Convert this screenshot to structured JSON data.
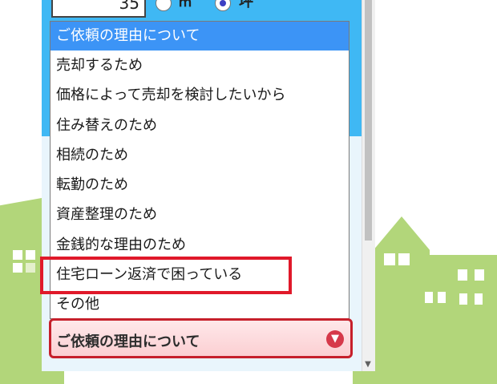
{
  "area": {
    "value": "35",
    "units": [
      {
        "label": "㎡",
        "checked": false
      },
      {
        "label": "坪",
        "checked": true
      }
    ]
  },
  "reason_dropdown": {
    "options": [
      "ご依頼の理由について",
      "売却するため",
      "価格によって売却を検討したいから",
      "住み替えのため",
      "相続のため",
      "転勤のため",
      "資産整理のため",
      "金銭的な理由のため",
      "住宅ローン返済で困っている",
      "その他"
    ],
    "highlighted_index": 0,
    "annotated_option": "住宅ローン返済で困っている"
  },
  "reason_select": {
    "value": "ご依頼の理由について",
    "icon": "chevron-down-circle-icon"
  },
  "colors": {
    "panel_blue": "#3fb8f4",
    "option_highlight": "#3c94f6",
    "annotation_red": "#e0192a",
    "select_border": "#c6202b",
    "scenery_green": "#b2d67a"
  }
}
